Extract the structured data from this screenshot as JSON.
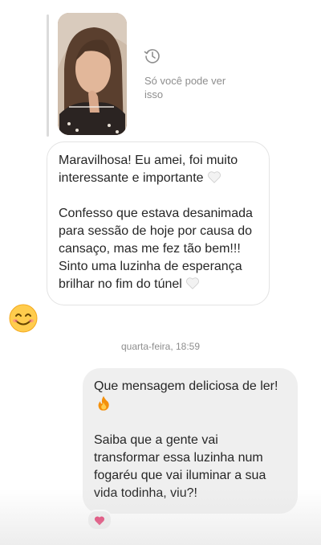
{
  "story_reply": {
    "expired_text": "Só você pode ver isso"
  },
  "incoming_message": {
    "paragraph_1": "Maravilhosa! Eu amei, foi muito interessante e importante",
    "paragraph_2": "Confesso que estava desanimada para sessão de hoje por causa do cansaço, mas me fez tão bem!!! Sinto uma luzinha de esperança brilhar no fim do túnel",
    "sender_avatar": "smiling-face-emoji"
  },
  "timestamp": "quarta-feira, 18:59",
  "outgoing_message": {
    "paragraph_1": "Que mensagem deliciosa de ler!",
    "paragraph_2": "Saiba que a gente vai transformar essa luzinha num fogaréu que vai iluminar a sua vida todinha, viu?!",
    "reaction": "red-heart"
  },
  "colors": {
    "incoming_bubble_bg": "#ffffff",
    "incoming_bubble_border": "#e3e3e3",
    "outgoing_bubble_bg": "#efefef",
    "meta_text": "#8e8e8e",
    "reaction_heart": "#e0245e"
  },
  "icons": [
    "expired-story-icon",
    "white-heart-icon",
    "fire-icon",
    "red-heart-icon",
    "smiling-face-emoji"
  ]
}
